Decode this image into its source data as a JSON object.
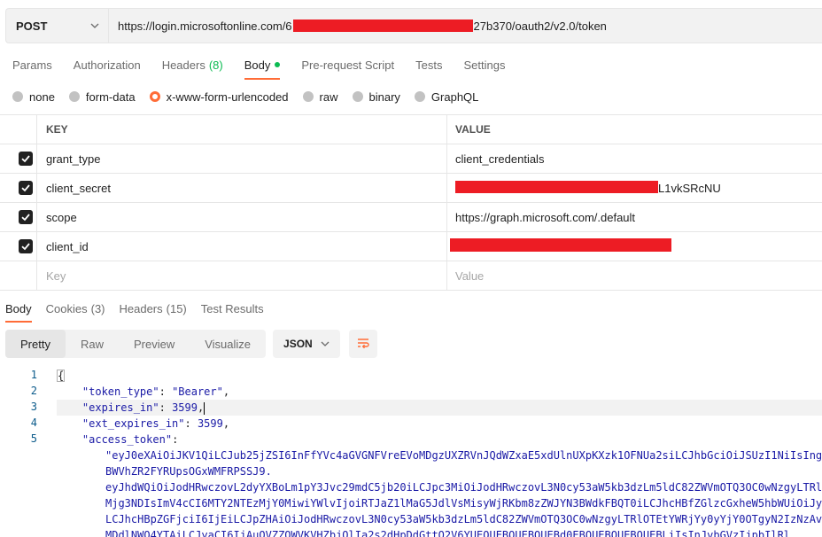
{
  "request": {
    "method": "POST",
    "url_prefix": "https://login.microsoftonline.com/6",
    "url_suffix": "27b370/oauth2/v2.0/token"
  },
  "request_tabs": [
    {
      "label": "Params"
    },
    {
      "label": "Authorization"
    },
    {
      "label": "Headers",
      "count": "(8)"
    },
    {
      "label": "Body"
    },
    {
      "label": "Pre-request Script"
    },
    {
      "label": "Tests"
    },
    {
      "label": "Settings"
    }
  ],
  "body_types": [
    {
      "label": "none"
    },
    {
      "label": "form-data"
    },
    {
      "label": "x-www-form-urlencoded"
    },
    {
      "label": "raw"
    },
    {
      "label": "binary"
    },
    {
      "label": "GraphQL"
    }
  ],
  "params_table": {
    "key_header": "KEY",
    "value_header": "VALUE",
    "rows": [
      {
        "key": "grant_type",
        "value": "client_credentials"
      },
      {
        "key": "client_secret",
        "value": "L1vkSRcNU"
      },
      {
        "key": "scope",
        "value": "https://graph.microsoft.com/.default"
      },
      {
        "key": "client_id",
        "value": ""
      }
    ],
    "key_placeholder": "Key",
    "value_placeholder": "Value"
  },
  "response_tabs": [
    {
      "label": "Body"
    },
    {
      "label": "Cookies",
      "count": "(3)"
    },
    {
      "label": "Headers",
      "count": "(15)"
    },
    {
      "label": "Test Results"
    }
  ],
  "view_modes": [
    "Pretty",
    "Raw",
    "Preview",
    "Visualize"
  ],
  "format": "JSON",
  "response_code": {
    "line_numbers": [
      "1",
      "2",
      "3",
      "4",
      "5"
    ],
    "open_brace": "{",
    "token_type_key": "\"token_type\"",
    "token_type_value": "\"Bearer\"",
    "expires_in_key": "\"expires_in\"",
    "expires_in_value": "3599",
    "ext_expires_in_key": "\"ext_expires_in\"",
    "ext_expires_in_value": "3599",
    "access_token_key": "\"access_token\"",
    "access_token_lines": [
      "\"eyJ0eXAiOiJKV1QiLCJub25jZSI6InFfYVc4aGVGNFVreEVoMDgzUXZRVnJQdWZxaE5xdUlnUXpKXzk1OFNUa2siLCJhbGciOiJSUzI1NiIsIng1",
      "BWVhZR2FYRUpsOGxWMFRPSSJ9.",
      "eyJhdWQiOiJodHRwczovL2dyYXBoLm1pY3Jvc29mdC5jb20iLCJpc3MiOiJodHRwczovL3N0cy53aW5kb3dzLm5ldC82ZWVmOTQ3OC0wNzgyLTRlOTEtYWRjYy0yYjY0OTgyN2IzNzAvIiwiaWF0IjoxNj",
      "Mjg3NDIsImV4cCI6MTY2NTEzMjY0MiwiYWlvIjoiRTJaZ1lMaG5JdlVsMisyWjRKbm8zZWJYN3BWdkFBQT0iLCJhcHBfZGlzcGxheW5hbWUiOiJy",
      "LCJhcHBpZGFjciI6IjEiLCJpZHAiOiJodHRwczovL3N0cy53aW5kb3dzLm5ldC82ZWVmOTQ3OC0wNzgyLTRlOTEtYWRjYy0yYjY0OTgyN2IzNzAvIi",
      "MDdlNWQ4YTAiLCJyaCI6IjAuQVZZQWVKVHZbjOlIa2s2dHpDdGttO2V6YUEQUEBQUEBQUEBd0EBQUEBQUEBQUEBLiIsInJvbGVzIjpbIlRl"
    ]
  }
}
